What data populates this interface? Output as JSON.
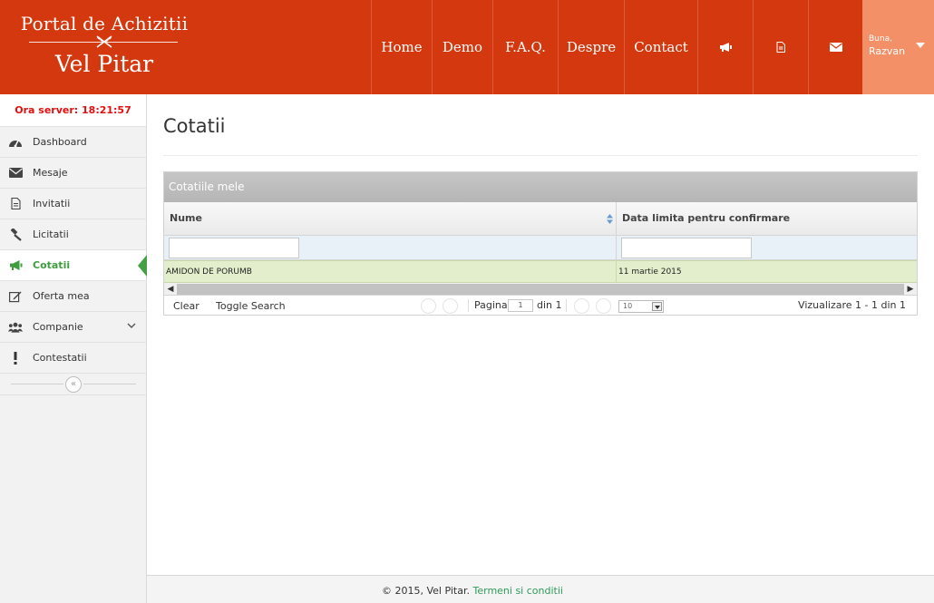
{
  "header": {
    "logo": {
      "line1": "Portal de Achizitii",
      "line2": "Vel Pitar"
    },
    "nav": [
      {
        "label": "Home",
        "name": "nav-home",
        "width": 67
      },
      {
        "label": "Demo",
        "name": "nav-demo",
        "width": 67
      },
      {
        "label": "F.A.Q.",
        "name": "nav-faq",
        "width": 72
      },
      {
        "label": "Despre",
        "name": "nav-despre",
        "width": 73
      },
      {
        "label": "Contact",
        "name": "nav-contact",
        "width": 81
      }
    ],
    "icon_nav": [
      {
        "icon": "megaphone-icon",
        "name": "nav-announcements"
      },
      {
        "icon": "document-icon",
        "name": "nav-documents"
      },
      {
        "icon": "envelope-icon",
        "name": "nav-messages"
      }
    ],
    "user": {
      "greeting": "Buna,",
      "name": "Razvan"
    },
    "colors": {
      "header_bg": "#d4380f",
      "user_bg": "#f39068"
    }
  },
  "sidebar": {
    "server_time": "Ora server: 18:21:57",
    "items": [
      {
        "label": "Dashboard",
        "icon": "dashboard-icon",
        "active": false
      },
      {
        "label": "Mesaje",
        "icon": "envelope-icon",
        "active": false
      },
      {
        "label": "Invitatii",
        "icon": "document-icon",
        "active": false
      },
      {
        "label": "Licitatii",
        "icon": "gavel-icon",
        "active": false
      },
      {
        "label": "Cotatii",
        "icon": "megaphone-icon",
        "active": true
      },
      {
        "label": "Oferta mea",
        "icon": "edit-icon",
        "active": false
      },
      {
        "label": "Companie",
        "icon": "users-icon",
        "active": false,
        "has_submenu": true
      },
      {
        "label": "Contestatii",
        "icon": "exclamation-icon",
        "active": false
      }
    ],
    "collapse_symbol": "«",
    "active_color": "#3f9d3f"
  },
  "main": {
    "title": "Cotatii",
    "grid": {
      "caption": "Cotatiile mele",
      "columns": [
        "Nume",
        "Data limita pentru confirmare"
      ],
      "rows": [
        [
          "AMIDON DE PORUMB",
          "11 martie 2015"
        ]
      ],
      "pager": {
        "clear": "Clear",
        "toggle_search": "Toggle Search",
        "page_label": "Pagina",
        "page_value": "1",
        "of_label": "din 1",
        "rows_per_page": "10",
        "view": "Vizualizare 1 - 1 din 1"
      }
    }
  },
  "footer": {
    "copyright": "© 2015, Vel Pitar.",
    "link": "Termeni si conditii"
  }
}
